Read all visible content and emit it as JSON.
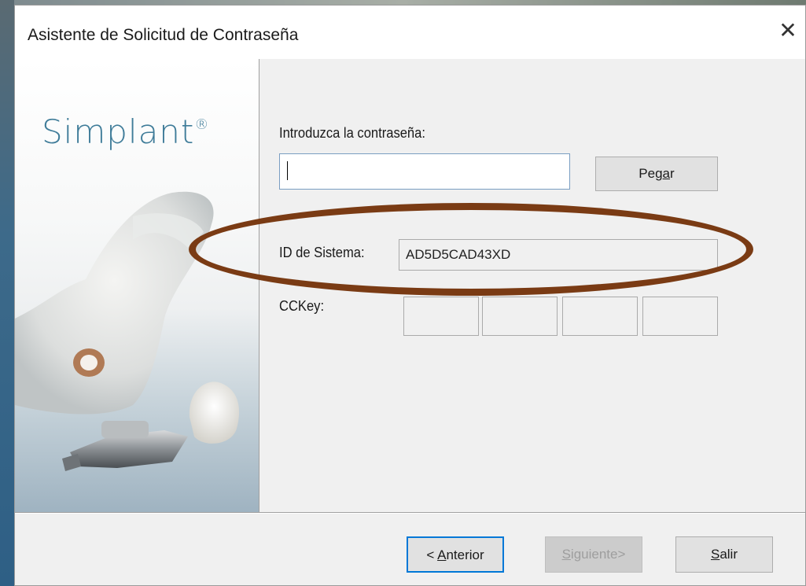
{
  "window": {
    "title": "Asistente de Solicitud de Contraseña",
    "close_glyph": "✕"
  },
  "side_panel": {
    "brand": "Simplant",
    "brand_mark": "®"
  },
  "form": {
    "password_label": "Introduzca la contraseña:",
    "password_value": "",
    "paste_label_pre": "Peg",
    "paste_label_accel": "a",
    "paste_label_post": "r",
    "system_id_label": "ID de Sistema:",
    "system_id_value": "AD5D5CAD43XD",
    "cckey_label": "CCKey:",
    "cckey_values": [
      "",
      "",
      "",
      ""
    ]
  },
  "footer": {
    "back_pre": "< ",
    "back_accel": "A",
    "back_post": "nterior",
    "next_accel": "S",
    "next_post": "iguiente>",
    "exit_accel": "S",
    "exit_post": "alir"
  },
  "colors": {
    "brand": "#3f7c99",
    "highlight": "#7a3b14",
    "focus_border": "#0078d7"
  }
}
